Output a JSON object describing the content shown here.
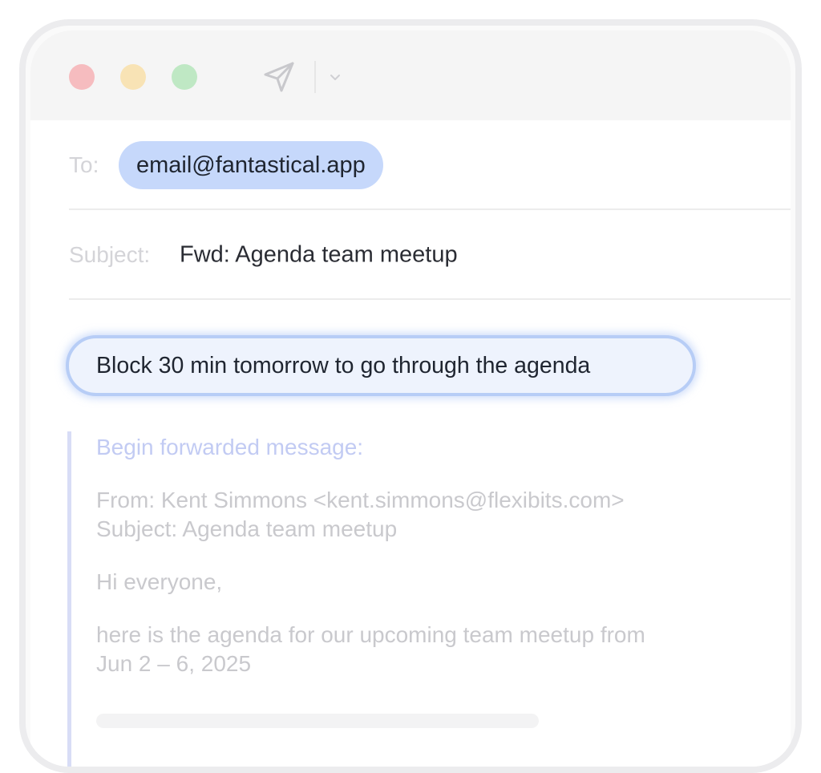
{
  "compose": {
    "to_label": "To:",
    "recipient": "email@fantastical.app",
    "subject_label": "Subject:",
    "subject_value": "Fwd: Agenda team meetup"
  },
  "command": {
    "text": "Block 30 min tomorrow to go through the agenda"
  },
  "forwarded": {
    "heading": "Begin forwarded message:",
    "from_line": "From: Kent Simmons <kent.simmons@flexibits.com>",
    "subject_line": "Subject: Agenda team meetup",
    "greeting": "Hi everyone,",
    "body_line_1": "here is the agenda for our upcoming team meetup from",
    "body_line_2": "Jun 2 – 6, 2025"
  },
  "colors": {
    "close": "#f6bcbf",
    "minimize": "#f8e3b5",
    "maximize": "#bfe8c4",
    "recipient_chip": "#c6d8fb",
    "command_border": "#b7cdf6",
    "forward_accent": "#c2cbf3"
  },
  "icons": {
    "send": "send-icon",
    "chevron": "chevron-down-icon"
  }
}
